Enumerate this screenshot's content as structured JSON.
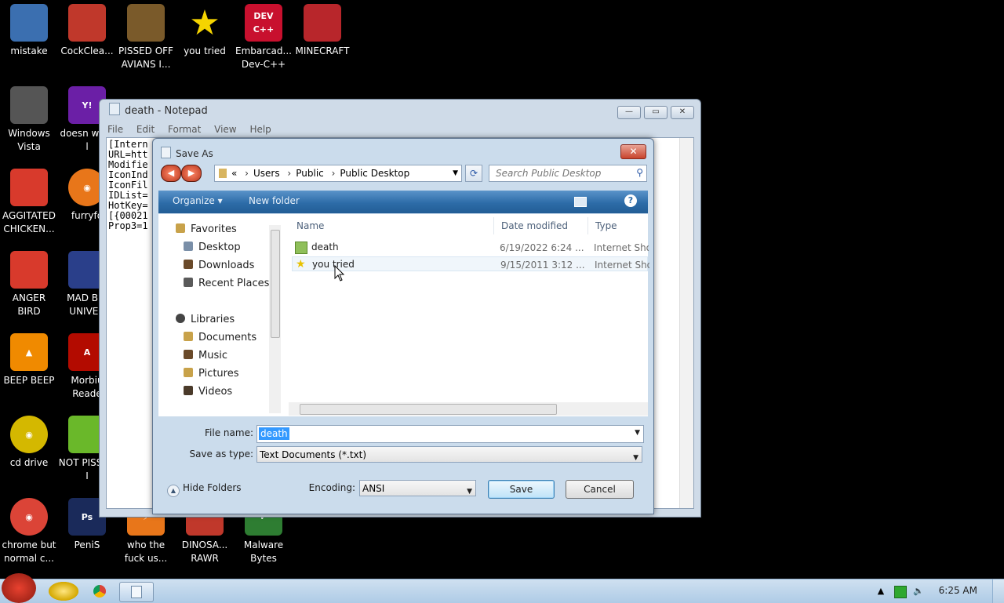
{
  "desktop": {
    "icons": [
      {
        "label": "mistake",
        "icon": "monitor-settings-icon",
        "color": "#3b6fb0"
      },
      {
        "label": "CockClea...",
        "icon": "ccleaner-icon",
        "color": "#c0382b"
      },
      {
        "label": "PISSED OFF AVIANS I...",
        "icon": "angry-birds-seasons-icon",
        "color": "#7a5a2a"
      },
      {
        "label": "you tried",
        "icon": "star-icon",
        "color": "#f5d400"
      },
      {
        "label": "Embarcad... Dev-C++",
        "icon": "devcpp-icon",
        "color": "#c8102e"
      },
      {
        "label": "MINECRAFT",
        "icon": "minecraft-icon",
        "color": "#b8262b"
      },
      {
        "label": "Windows Vista",
        "icon": "recycle-bin-icon",
        "color": "#555555"
      },
      {
        "label": "doesn work l",
        "icon": "yahoo-messenger-icon",
        "color": "#6b1fa6"
      },
      {
        "label": "AGGITATED CHICKEN...",
        "icon": "angry-bird-icon",
        "color": "#d83a2c"
      },
      {
        "label": "furryfo",
        "icon": "firefox-icon",
        "color": "#e8761a"
      },
      {
        "label": "ANGER BIRD",
        "icon": "angry-bird-icon",
        "color": "#d83a2c"
      },
      {
        "label": "MAD BIR UNIVER",
        "icon": "angry-birds-space-icon",
        "color": "#2a3f8a"
      },
      {
        "label": "BEEP BEEP",
        "icon": "vlc-icon",
        "color": "#f08a00"
      },
      {
        "label": "Morbiu Reade",
        "icon": "acrobat-reader-icon",
        "color": "#b30b00"
      },
      {
        "label": "cd drive",
        "icon": "cd-icon",
        "color": "#d4b800"
      },
      {
        "label": "NOT PISSED I",
        "icon": "bad-piggies-icon",
        "color": "#6ab82a"
      },
      {
        "label": "chrome but normal c...",
        "icon": "chrome-icon",
        "color": "#db4437"
      },
      {
        "label": "PeniS",
        "icon": "photoshop-icon",
        "color": "#1a2a5a"
      },
      {
        "label": "who the fuck us...",
        "icon": "winamp-icon",
        "color": "#e8761a"
      },
      {
        "label": "DINOSA... RAWR",
        "icon": "angry-birds-rio-icon",
        "color": "#c0382b"
      },
      {
        "label": "Malware Bytes",
        "icon": "malwarebytes-icon",
        "color": "#2e7d32"
      }
    ]
  },
  "notepad": {
    "title": "death - Notepad",
    "menu": [
      "File",
      "Edit",
      "Format",
      "View",
      "Help"
    ],
    "text": "[Intern\nURL=htt\nModifie\nIconInd\nIconFil\nIDList=\nHotKey=\n[{00021\nProp3=1"
  },
  "dialog": {
    "title": "Save As",
    "close": "✕",
    "address": {
      "chevron": "«",
      "parts": [
        "Users",
        "Public",
        "Public Desktop"
      ]
    },
    "search_placeholder": "Search Public Desktop",
    "toolbar": {
      "organize": "Organize ▾",
      "new_folder": "New folder",
      "help": "?"
    },
    "nav": {
      "favorites": "Favorites",
      "fav_items": [
        "Desktop",
        "Downloads",
        "Recent Places"
      ],
      "libraries": "Libraries",
      "lib_items": [
        "Documents",
        "Music",
        "Pictures",
        "Videos"
      ]
    },
    "columns": {
      "name": "Name",
      "date": "Date modified",
      "type": "Type"
    },
    "files": [
      {
        "name": "death",
        "date": "6/19/2022 6:24 ...",
        "type": "Internet Sho"
      },
      {
        "name": "you tried",
        "date": "9/15/2011 3:12 ...",
        "type": "Internet Sho"
      }
    ],
    "file_name_label": "File name:",
    "file_name_value": "death",
    "save_type_label": "Save as type:",
    "save_type_value": "Text Documents (*.txt)",
    "hide_folders": "Hide Folders",
    "encoding_label": "Encoding:",
    "encoding_value": "ANSI",
    "save_button": "Save",
    "cancel_button": "Cancel"
  },
  "taskbar": {
    "clock": "6:25 AM"
  }
}
